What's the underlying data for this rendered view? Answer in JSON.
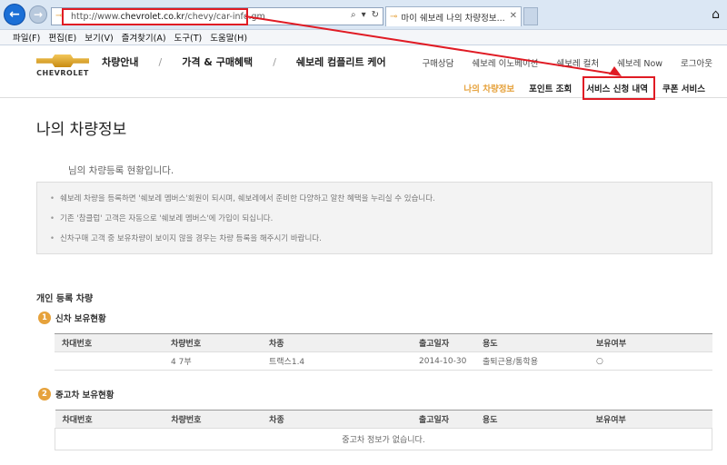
{
  "browser": {
    "url_prefix": "http://www.",
    "url_domain": "chevrolet.co.kr",
    "url_path": "/chevy/car-info.gm",
    "address_tools": [
      "⌕",
      "▾",
      "↻"
    ],
    "tab_title": "마이 쉐보레 나의 차량정보...",
    "menu": [
      "파일(F)",
      "편집(E)",
      "보기(V)",
      "즐겨찾기(A)",
      "도구(T)",
      "도움말(H)"
    ]
  },
  "header": {
    "logo_text": "CHEVROLET",
    "main_nav": [
      "차량안내",
      "가격 & 구매혜택",
      "쉐보레 컴플리트 케어"
    ],
    "util_nav": [
      "구매상담",
      "쉐보레 이노베이션",
      "쉐보레 컬처",
      "쉐보레 Now",
      "로그아웃"
    ],
    "sub_nav": [
      "나의 차량정보",
      "포인트 조회",
      "서비스 신청 내역",
      "쿠폰 서비스"
    ]
  },
  "content": {
    "page_title": "나의 차량정보",
    "greeting": "님의 차량등록 현황입니다.",
    "notices": [
      "쉐보레 차량을 등록하면 '쉐보레 멤버스'회원이 되시며, 쉐보레에서 준비한 다양하고 알찬 혜택을 누리실 수 있습니다.",
      "기존 '참클럽' 고객은 자동으로 '쉐보레 멤버스'에 가입이 되십니다.",
      "신차구매 고객 중 보유차량이 보이지 않을 경우는 차량 등록을 해주시기 바랍니다."
    ],
    "section_title": "개인 등록 차량",
    "new_car": {
      "badge": "1",
      "title": "신차 보유현황",
      "columns": [
        "차대번호",
        "차량번호",
        "차종",
        "출고일자",
        "용도",
        "보유여부"
      ],
      "rows": [
        [
          "",
          "4 7부",
          "트랙스1.4",
          "2014-10-30",
          "출퇴근용/통학용",
          "○"
        ]
      ]
    },
    "used_car": {
      "badge": "2",
      "title": "중고차 보유현황",
      "columns": [
        "차대번호",
        "차량번호",
        "차종",
        "출고일자",
        "용도",
        "보유여부"
      ],
      "empty_message": "중고차 정보가 없습니다."
    }
  },
  "colors": {
    "accent": "#e6a23c",
    "annotation": "#e01b24"
  }
}
